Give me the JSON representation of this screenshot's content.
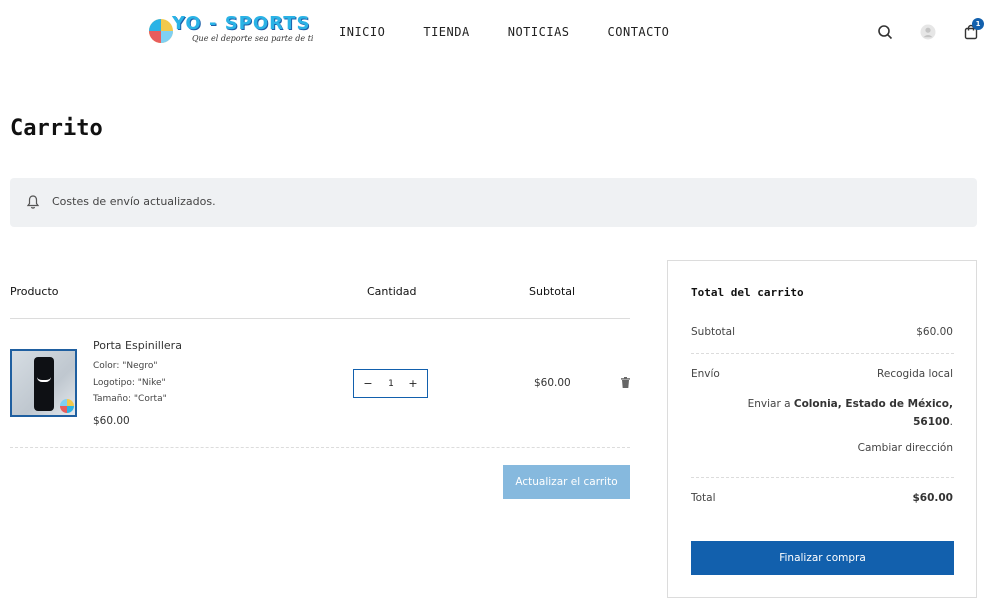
{
  "header": {
    "logo_text": "YO - SPORTS",
    "logo_tagline": "Que el deporte sea parte de ti",
    "nav": [
      "INICIO",
      "TIENDA",
      "NOTICIAS",
      "CONTACTO"
    ],
    "cart_count": "1",
    "accent_color": "#1260ad"
  },
  "page": {
    "title": "Carrito"
  },
  "notice": {
    "text": "Costes de envío actualizados."
  },
  "cart": {
    "headers": {
      "product": "Producto",
      "quantity": "Cantidad",
      "subtotal": "Subtotal"
    },
    "items": [
      {
        "name": "Porta Espinillera",
        "meta": [
          "Color: \"Negro\"",
          "Logotipo: \"Nike\"",
          "Tamaño: \"Corta\""
        ],
        "price": "$60.00",
        "quantity": "1",
        "subtotal": "$60.00"
      }
    ],
    "update_label": "Actualizar el carrito",
    "update_color": "#86b9de"
  },
  "totals": {
    "title": "Total del carrito",
    "subtotal_label": "Subtotal",
    "subtotal_value": "$60.00",
    "shipping_label": "Envío",
    "shipping_method": "Recogida local",
    "ship_prefix": "Enviar a ",
    "ship_location": "Colonia, Estado de México,",
    "ship_zip": "56100",
    "ship_suffix": ".",
    "change_address": "Cambiar dirección",
    "total_label": "Total",
    "total_value": "$60.00",
    "checkout_label": "Finalizar compra"
  }
}
